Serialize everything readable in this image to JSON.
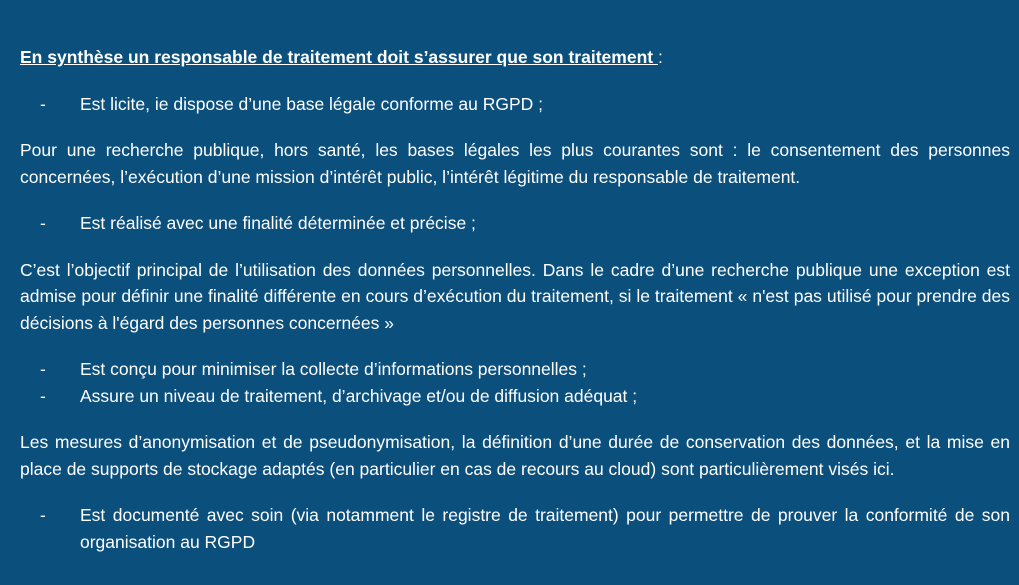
{
  "heading": {
    "text": "En synthèse un responsable de traitement doit s’assurer que son traitement ",
    "colon": ":"
  },
  "bullet_dash": "-",
  "sections": {
    "b1": "Est licite, ie dispose d’une base légale conforme au RGPD ;",
    "p1": "Pour une recherche publique, hors santé, les bases légales les plus courantes sont : le consentement des personnes concernées, l’exécution d’une mission d’intérêt public, l’intérêt légitime du responsable de traitement.",
    "b2": "Est réalisé avec une finalité déterminée et précise  ;",
    "p2": "C’est l’objectif principal de l’utilisation des données personnelles. Dans le cadre d’une recherche publique une exception est admise pour définir une finalité différente en cours d’exécution du traitement, si le traitement « n'est pas utilisé pour prendre des décisions à l'égard des personnes concernées »",
    "b3": "Est conçu pour minimiser la collecte d’informations personnelles ;",
    "b4": "Assure un niveau de traitement, d’archivage et/ou de diffusion adéquat ;",
    "p3": "Les mesures d’anonymisation et de pseudonymisation, la définition d’une durée de conservation des données, et la mise en place de supports de stockage adaptés (en particulier en cas de recours au cloud) sont particulièrement visés ici.",
    "b5": "Est documenté avec soin (via notamment le registre de traitement) pour permettre de prouver la conformité de son organisation au RGPD"
  }
}
